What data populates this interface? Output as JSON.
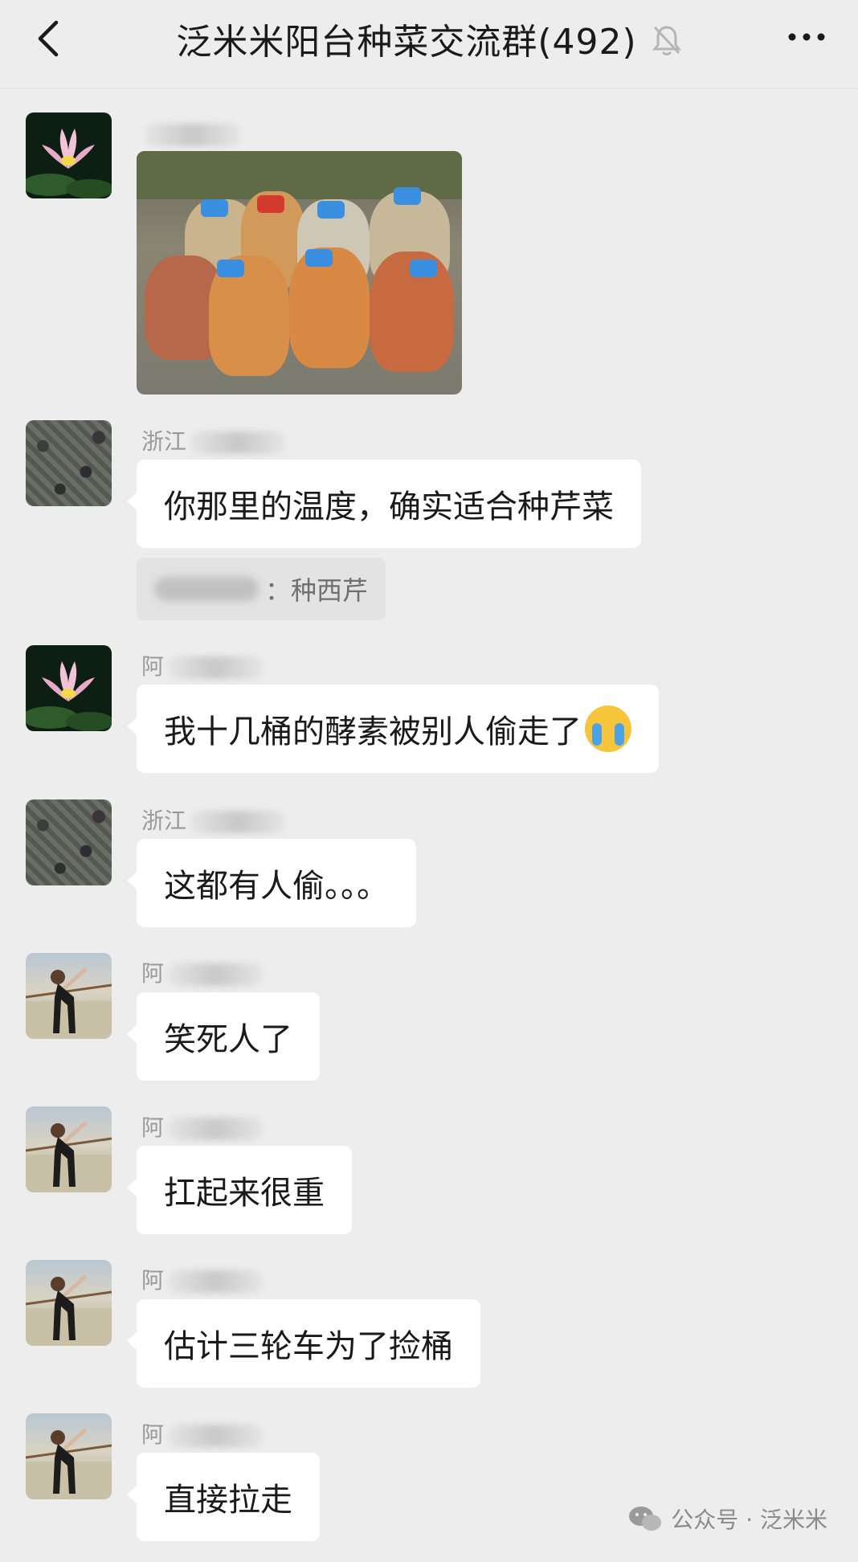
{
  "header": {
    "title": "泛米米阳台种菜交流群(492)",
    "icons": {
      "back": "back-chevron-icon",
      "mute": "bell-muted-icon",
      "more": "more-dots-icon"
    }
  },
  "messages": [
    {
      "sender": "",
      "type": "image",
      "avatar": "lotus-avatar"
    },
    {
      "sender": "浙江",
      "type": "text",
      "text": "你那里的温度，确实适合种芹菜",
      "avatar": "field-avatar",
      "quote": {
        "text": "：种西芹"
      }
    },
    {
      "sender": "阿",
      "type": "text",
      "text": "我十几桶的酵素被别人偷走了",
      "avatar": "lotus-avatar",
      "emoji": "crying-face"
    },
    {
      "sender": "浙江",
      "type": "text",
      "text": "这都有人偷。。。",
      "avatar": "field-avatar"
    },
    {
      "sender": "阿",
      "type": "text",
      "text": "笑死人了",
      "avatar": "girl-avatar"
    },
    {
      "sender": "阿",
      "type": "text",
      "text": "扛起来很重",
      "avatar": "girl-avatar"
    },
    {
      "sender": "阿",
      "type": "text",
      "text": "估计三轮车为了捡桶",
      "avatar": "girl-avatar"
    },
    {
      "sender": "阿",
      "type": "text",
      "text": "直接拉走",
      "avatar": "girl-avatar"
    }
  ],
  "footer": {
    "text": "公众号 · 泛米米",
    "icon": "wechat-icon"
  },
  "colors": {
    "background": "#ededed",
    "bubble": "#ffffff",
    "quote": "#e3e3e3",
    "name": "#9a9a9a"
  }
}
